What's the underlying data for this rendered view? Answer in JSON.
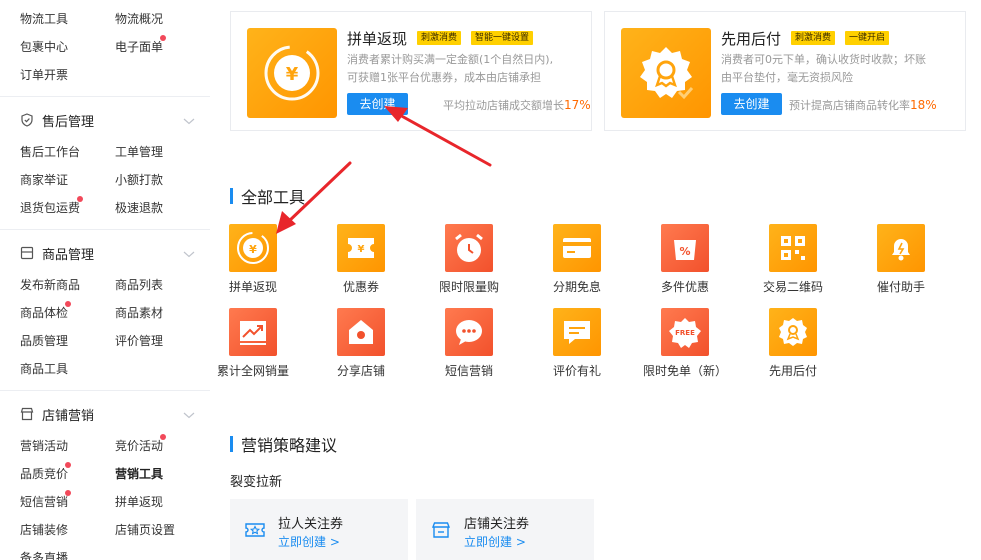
{
  "sidebar": {
    "top_rows": [
      {
        "left": "物流工具",
        "right": "物流概况"
      },
      {
        "left": "包裹中心",
        "right": "电子面单"
      },
      {
        "left": "订单开票",
        "right": ""
      }
    ],
    "sections": [
      {
        "title": "售后管理",
        "icon": "shield-icon",
        "rows": [
          {
            "left": "售后工作台",
            "right": "工单管理"
          },
          {
            "left": "商家举证",
            "right": "小额打款"
          },
          {
            "left": "退货包运费",
            "right": "极速退款"
          }
        ]
      },
      {
        "title": "商品管理",
        "icon": "box-icon",
        "rows": [
          {
            "left": "发布新商品",
            "right": "商品列表"
          },
          {
            "left": "商品体检",
            "right": "商品素材"
          },
          {
            "left": "品质管理",
            "right": "评价管理"
          },
          {
            "left": "商品工具",
            "right": ""
          }
        ]
      },
      {
        "title": "店铺营销",
        "icon": "store-icon",
        "rows": [
          {
            "left": "营销活动",
            "right": "竞价活动"
          },
          {
            "left": "品质竞价",
            "right": "营销工具"
          },
          {
            "left": "短信营销",
            "right": "拼单返现"
          },
          {
            "left": "店铺装修",
            "right": "店铺页设置"
          },
          {
            "left": "备多直播",
            "right": ""
          }
        ]
      }
    ]
  },
  "featured": [
    {
      "title": "拼单返现",
      "tags": [
        "刺激消费",
        "智能一键设置"
      ],
      "desc_lines": [
        "消费者累计购买满一定金额(1个自然日内),",
        "可获赠1张平台优惠券，成本由店铺承担"
      ],
      "button": "去创建",
      "stat_text": "平均拉动店铺成交额增长",
      "stat_pct": "17%",
      "icon": "yen-coin-icon"
    },
    {
      "title": "先用后付",
      "tags": [
        "刺激消费",
        "一键开启"
      ],
      "desc_lines": [
        "消费者可0元下单，确认收货时收款；坏账",
        "由平台垫付，毫无资损风险"
      ],
      "button": "去创建",
      "stat_text": "预计提高店铺商品转化率",
      "stat_pct": "18%",
      "icon": "badge-check-icon"
    }
  ],
  "all_tools": {
    "title": "全部工具",
    "items": [
      {
        "label": "拼单返现",
        "icon": "yen-coin-icon",
        "color": "#ffa40d"
      },
      {
        "label": "优惠券",
        "icon": "coupon-icon",
        "color": "#ffa40d"
      },
      {
        "label": "限时限量购",
        "icon": "alarm-clock-icon",
        "color": "#f2512c"
      },
      {
        "label": "分期免息",
        "icon": "credit-card-icon",
        "color": "#ffa40d"
      },
      {
        "label": "多件优惠",
        "icon": "percent-bag-icon",
        "color": "#f2512c"
      },
      {
        "label": "交易二维码",
        "icon": "qrcode-icon",
        "color": "#ffa40d"
      },
      {
        "label": "催付助手",
        "icon": "bell-icon",
        "color": "#ffa40d"
      },
      {
        "label": "累计全网销量",
        "icon": "trend-chart-icon",
        "color": "#f2512c"
      },
      {
        "label": "分享店铺",
        "icon": "share-store-icon",
        "color": "#f2512c"
      },
      {
        "label": "短信营销",
        "icon": "message-icon",
        "color": "#f2512c"
      },
      {
        "label": "评价有礼",
        "icon": "comment-icon",
        "color": "#ffa40d"
      },
      {
        "label": "限时免单（新）",
        "icon": "free-badge-icon",
        "color": "#f2512c"
      },
      {
        "label": "先用后付",
        "icon": "badge-check-icon",
        "color": "#ffa40d"
      }
    ]
  },
  "strategy": {
    "title": "营销策略建议",
    "subtitle": "裂变拉新",
    "cards": [
      {
        "title": "拉人关注券",
        "link": "立即创建 >",
        "icon": "star-ticket-icon"
      },
      {
        "title": "店铺关注券",
        "link": "立即创建 >",
        "icon": "store-ticket-icon"
      }
    ]
  },
  "colors": {
    "accent": "#1a8cf0",
    "tag_bg": "#ffd000",
    "orange": "#ffa40d",
    "red_orange": "#f2512c",
    "stat_pct": "#ff6a00",
    "red_dot": "#f2495a",
    "annotation_arrow": "#e8262b"
  }
}
